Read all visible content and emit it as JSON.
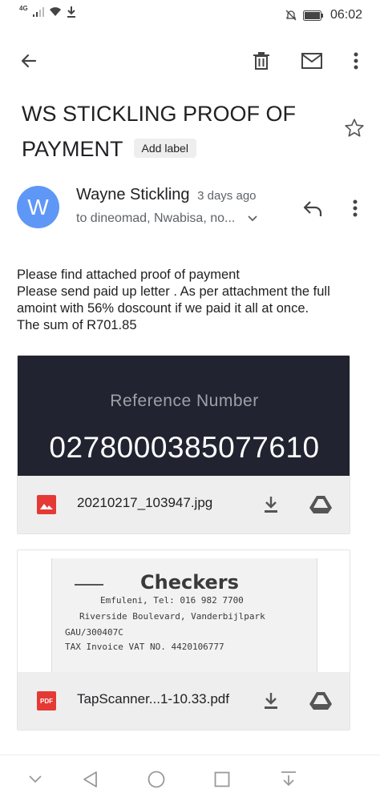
{
  "status_bar": {
    "network": "4G",
    "time": "06:02"
  },
  "app_bar": {
    "back_icon": "arrow-left-icon",
    "delete_icon": "trash-icon",
    "mail_icon": "mail-icon",
    "more_icon": "more-vert-icon"
  },
  "email": {
    "subject": "WS STICKLING PROOF OF PAYMENT",
    "add_label": "Add label",
    "sender": {
      "initial": "W",
      "name": "Wayne Stickling",
      "time": "3 days ago",
      "recipients": "to dineomad, Nwabisa, no...",
      "avatar_color": "#5e97f6"
    },
    "body_lines": [
      "Please find attached proof of payment",
      "Please send paid up letter . As per attachment the full amoint with 56% doscount if we paid it all at once.",
      "The sum of R701.85"
    ]
  },
  "attachments": [
    {
      "type": "image",
      "preview_label": "Reference Number",
      "preview_value": "0278000385077610",
      "file_name": "20210217_103947.jpg",
      "icon": "image-icon",
      "icon_color": "#e53935"
    },
    {
      "type": "pdf",
      "preview_brand": "Checkers",
      "preview_lines": [
        "Emfuleni, Tel: 016 982 7700",
        "Riverside Boulevard, Vanderbijlpark",
        "GAU/300407C",
        "TAX Invoice VAT NO. 4420106777"
      ],
      "file_name": "TapScanner...1-10.33.pdf",
      "icon": "pdf-icon",
      "icon_label": "PDF",
      "icon_color": "#e53935"
    }
  ],
  "nav_bar": {
    "items": [
      "chevron-down-icon",
      "back-triangle-icon",
      "home-circle-icon",
      "recents-square-icon",
      "notification-pull-icon"
    ]
  }
}
